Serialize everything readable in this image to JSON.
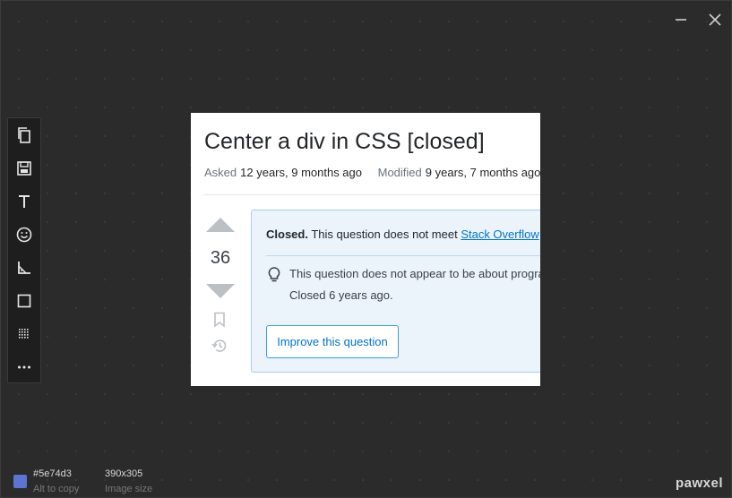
{
  "window": {
    "controls": {
      "minimize_icon": "minimize-icon",
      "close_icon": "close-icon"
    }
  },
  "toolbar": {
    "tools": [
      {
        "name": "copy",
        "icon": "copy-icon"
      },
      {
        "name": "save",
        "icon": "save-icon"
      },
      {
        "name": "text",
        "icon": "text-icon"
      },
      {
        "name": "emoji",
        "icon": "smiley-icon"
      },
      {
        "name": "measure",
        "icon": "ruler-icon"
      },
      {
        "name": "rectangle",
        "icon": "rectangle-icon"
      },
      {
        "name": "pixelate",
        "icon": "pixel-grid-icon"
      },
      {
        "name": "more",
        "icon": "more-icon"
      }
    ]
  },
  "screenshot": {
    "title": "Center a div in CSS [closed]",
    "asked_label": "Asked",
    "asked_value": "12 years, 9 months ago",
    "modified_label": "Modified",
    "modified_value": "9 years, 7 months ago",
    "vote_count": "36",
    "notice": {
      "closed_label": "Closed.",
      "closed_text": "This question does not meet",
      "link_text": "Stack Overflow",
      "reason_text": "This question does not appear to be about programming",
      "closed_time": "Closed 6 years ago.",
      "improve_button": "Improve this question"
    },
    "colors": {
      "notice_bg": "#ebf4fb",
      "notice_border": "#a6ceed",
      "link": "#0074cc"
    }
  },
  "footer": {
    "color_hex": "#5e74d3",
    "color_hint": "Alt to copy",
    "image_size": "390x305",
    "image_size_label": "Image size",
    "brand": "pawxel"
  }
}
